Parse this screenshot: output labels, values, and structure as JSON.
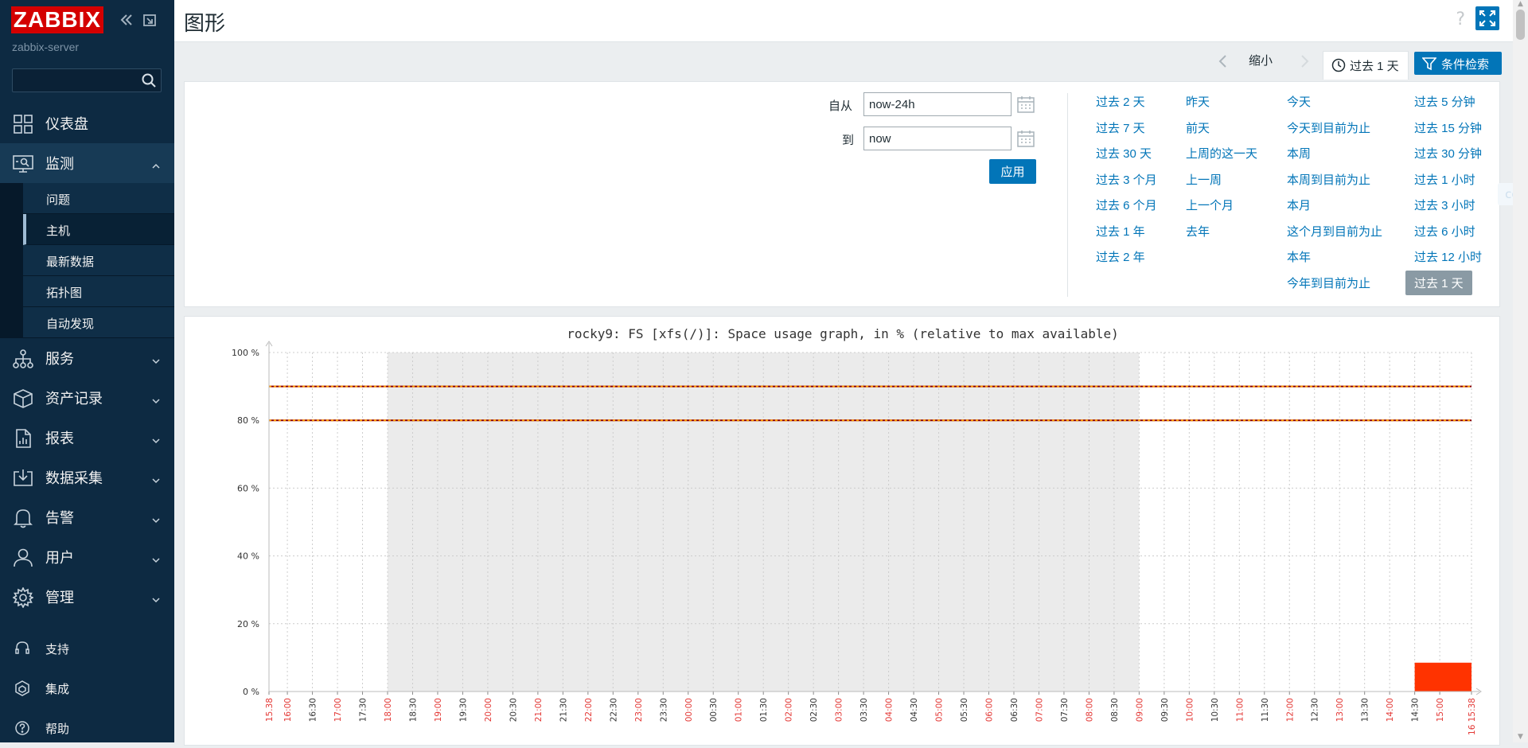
{
  "brand": {
    "logo": "ZABBIX",
    "server": "zabbix-server",
    "accent": "#d40000"
  },
  "sidebar": {
    "search_placeholder": "",
    "menu": [
      {
        "label": "仪表盘",
        "icon": "dashboard-icon"
      },
      {
        "label": "监测",
        "icon": "monitoring-icon",
        "open": true
      },
      {
        "label": "服务",
        "icon": "services-icon"
      },
      {
        "label": "资产记录",
        "icon": "inventory-icon"
      },
      {
        "label": "报表",
        "icon": "reports-icon"
      },
      {
        "label": "数据采集",
        "icon": "data-collection-icon"
      },
      {
        "label": "告警",
        "icon": "alerts-icon"
      },
      {
        "label": "用户",
        "icon": "users-icon"
      },
      {
        "label": "管理",
        "icon": "administration-icon"
      }
    ],
    "submenu": [
      {
        "label": "问题"
      },
      {
        "label": "主机",
        "active": true
      },
      {
        "label": "最新数据"
      },
      {
        "label": "拓扑图"
      },
      {
        "label": "自动发现"
      }
    ],
    "bottom": [
      {
        "label": "支持",
        "icon": "support-icon"
      },
      {
        "label": "集成",
        "icon": "integrations-icon"
      },
      {
        "label": "帮助",
        "icon": "help-icon"
      }
    ]
  },
  "header": {
    "title": "图形",
    "help": "?"
  },
  "filter_tabs": {
    "zoom_out": "缩小",
    "time": "过去 1 天",
    "filter": "条件检索"
  },
  "filter": {
    "from_label": "自从",
    "from_value": "now-24h",
    "to_label": "到",
    "to_value": "now",
    "apply": "应用",
    "copy": "copy",
    "quick_columns": [
      [
        "过去 2 天",
        "过去 7 天",
        "过去 30 天",
        "过去 3 个月",
        "过去 6 个月",
        "过去 1 年",
        "过去 2 年"
      ],
      [
        "昨天",
        "前天",
        "上周的这一天",
        "上一周",
        "上一个月",
        "去年"
      ],
      [
        "今天",
        "今天到目前为止",
        "本周",
        "本周到目前为止",
        "本月",
        "这个月到目前为止",
        "本年",
        "今年到目前为止"
      ],
      [
        "过去 5 分钟",
        "过去 15 分钟",
        "过去 30 分钟",
        "过去 1 小时",
        "过去 3 小时",
        "过去 6 小时",
        "过去 12 小时",
        "过去 1 天"
      ]
    ],
    "selected": "过去 1 天"
  },
  "graph": {
    "title": "rocky9: FS [xfs(/)]: Space usage graph, in % (relative to max available)",
    "colors": {
      "bar": "#ff3300",
      "trigger_high": "#8b0000",
      "trigger_warn": "#ff9900",
      "highlight_red": "#e33734",
      "nonwork": "#ebebeb"
    }
  },
  "chart_data": {
    "type": "bar",
    "title": "rocky9: FS [xfs(/)]: Space usage graph, in % (relative to max available)",
    "y_ticks": [
      "100 %",
      "80 %",
      "60 %",
      "40 %",
      "20 %",
      "0 %"
    ],
    "ylim": [
      0,
      100
    ],
    "x_ticks": [
      "15.38",
      "16:00",
      "16:30",
      "17:00",
      "17:30",
      "18:00",
      "18:30",
      "19:00",
      "19:30",
      "20:00",
      "20:30",
      "21:00",
      "21:30",
      "22:00",
      "22:30",
      "23:00",
      "23:30",
      "00:00",
      "00:30",
      "01:00",
      "01:30",
      "02:00",
      "02:30",
      "03:00",
      "03:30",
      "04:00",
      "04:30",
      "05:00",
      "05:30",
      "06:00",
      "06:30",
      "07:00",
      "07:30",
      "08:00",
      "08:30",
      "09:00",
      "09:30",
      "10:00",
      "10:30",
      "11:00",
      "11:30",
      "12:00",
      "12:30",
      "13:00",
      "13:30",
      "14:00",
      "14:30",
      "15:00",
      "16 15:38"
    ],
    "threshold_lines": [
      90,
      80
    ],
    "series": [
      {
        "values": [
          {
            "x_start": "14:30",
            "x_end": "15:38",
            "y": 8.5
          }
        ]
      }
    ],
    "nonwork_shading": [
      "18:00",
      "09:00"
    ],
    "grid": true
  }
}
